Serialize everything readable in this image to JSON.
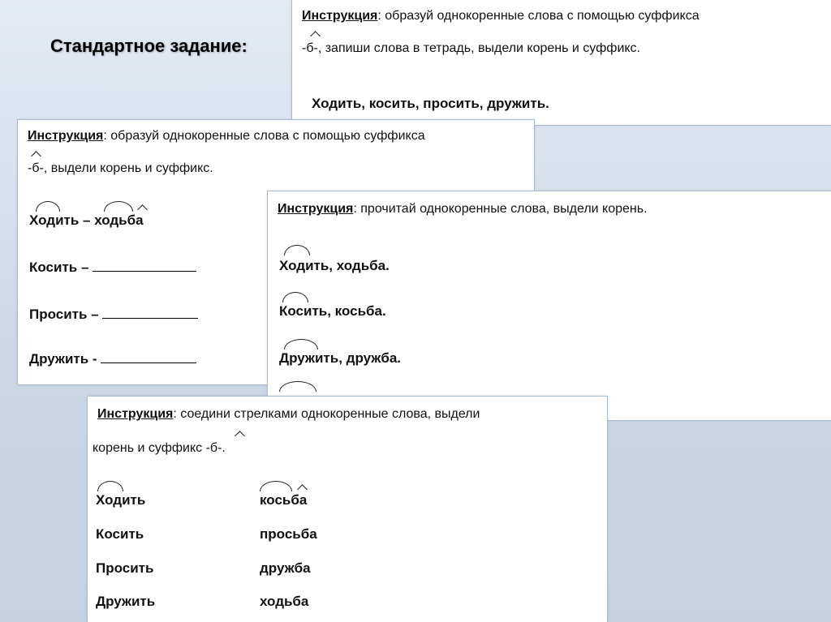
{
  "slide": {
    "title": "Стандартное задание:"
  },
  "card1": {
    "instr_label": "Инструкция",
    "instr_text": ":  образуй однокоренные слова с помощью суффикса",
    "instr_text2": "-б-, запиши слова в тетрадь, выдели корень и суффикс.",
    "words": "Ходить, косить, просить, дружить."
  },
  "card2": {
    "instr_label": "Инструкция",
    "instr_text": ":  образуй однокоренные слова с помощью суффикса",
    "instr_text2": "-б-, выдели корень и суффикс.",
    "lines": [
      "Ходить – ходьба",
      "Косить – ",
      "Просить – ",
      "Дружить - "
    ]
  },
  "card3": {
    "instr_label": "Инструкция",
    "instr_text": ":  прочитай однокоренные слова, выдели корень.",
    "lines": [
      "Ходить, ходьба.",
      "Косить, косьба.",
      "Дружить, дружба."
    ]
  },
  "card4": {
    "instr_label": "Инструкция",
    "instr_text": ":  соедини стрелками однокоренные слова,  выдели",
    "instr_text2": "корень и суффикс -б-.",
    "left": [
      "Ходить",
      "Косить",
      "Просить",
      "Дружить"
    ],
    "right": [
      "косьба",
      "просьба",
      "дружба",
      "ходьба"
    ]
  }
}
